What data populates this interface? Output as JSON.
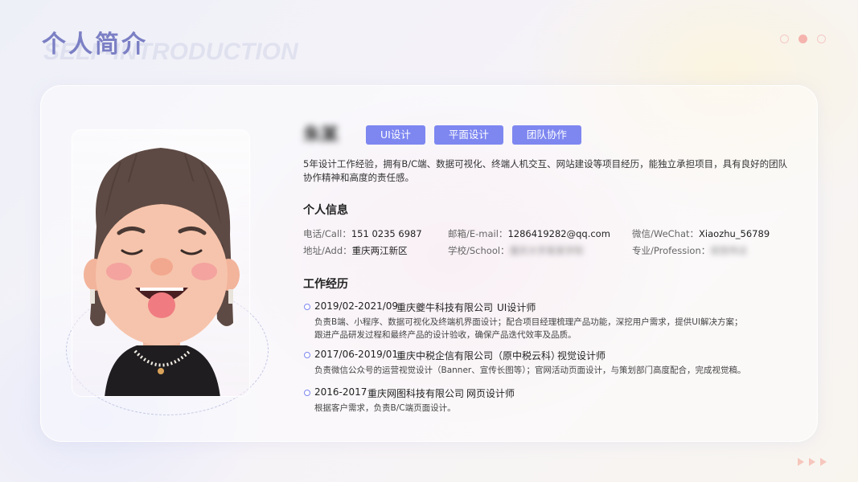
{
  "header": {
    "title": "个人简介",
    "subtitle": "SELF-INTRODUCTION"
  },
  "profile": {
    "name": "朱某",
    "tags": [
      "UI设计",
      "平面设计",
      "团队协作"
    ],
    "intro": "5年设计工作经验，拥有B/C端、数据可视化、终端人机交互、网站建设等项目经历，能独立承担项目，具有良好的团队协作精神和高度的责任感。"
  },
  "personal_info": {
    "title": "个人信息",
    "phone_label": "电话/Call：",
    "phone": "151 0235 6987",
    "email_label": "邮箱/E-mail：",
    "email": "1286419282@qq.com",
    "wechat_label": "微信/WeChat：",
    "wechat": "Xiaozhu_56789",
    "address_label": "地址/Add：",
    "address": "重庆两江新区",
    "school_label": "学校/School：",
    "school": "重庆大学某某学院",
    "major_label": "专业/Profession：",
    "major": "视觉传达"
  },
  "work": {
    "title": "工作经历",
    "items": [
      {
        "period": "2019/02-2021/09",
        "company": "重庆夔牛科技有限公司",
        "role": "UI设计师",
        "desc": [
          "负责B端、小程序、数据可视化及终端机界面设计；配合项目经理梳理产品功能，深挖用户需求，提供UI解决方案；",
          "跟进产品研发过程和最终产品的设计验收，确保产品迭代效率及品质。"
        ]
      },
      {
        "period": "2017/06-2019/01",
        "company": "重庆中税企信有限公司（原中税云科）",
        "role": "视觉设计师",
        "desc": [
          "负责微信公众号的运营视觉设计（Banner、宣传长图等）；官网活动页面设计，与策划部门高度配合，完成视觉稿。"
        ]
      },
      {
        "period": "2016-2017",
        "company": "重庆网图科技有限公司",
        "role": "网页设计师",
        "desc": [
          "根据客户需求，负责B/C端页面设计。"
        ]
      }
    ]
  },
  "colors": {
    "accent": "#7e87f0",
    "title": "#7b7fc4",
    "dot_active": "#f5b3ad"
  },
  "icons": [
    "pagination-dots-icon",
    "arrows-right-icon"
  ]
}
